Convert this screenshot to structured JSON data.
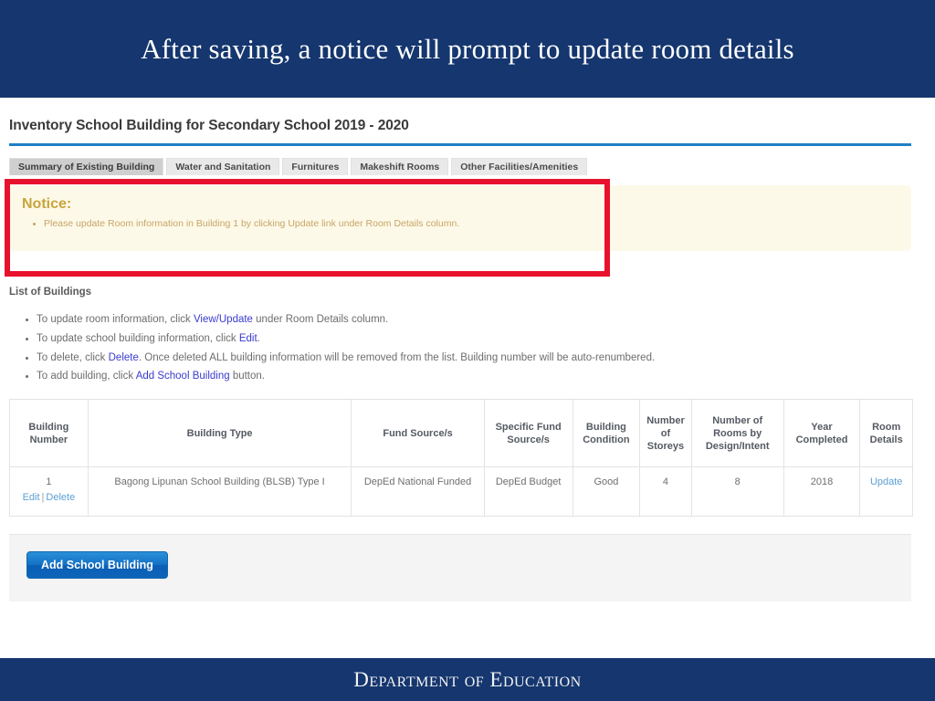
{
  "slide": {
    "title": "After saving, a notice will prompt to update room details",
    "band_color": "#15366e",
    "footer_text": "Department of Education"
  },
  "page": {
    "heading": "Inventory School Building for Secondary School 2019 - 2020",
    "rule_color": "#1f7fc4"
  },
  "tabs": [
    {
      "label": "Summary of Existing Building",
      "active": true
    },
    {
      "label": "Water and Sanitation",
      "active": false
    },
    {
      "label": "Furnitures",
      "active": false
    },
    {
      "label": "Makeshift Rooms",
      "active": false
    },
    {
      "label": "Other Facilities/Amenities",
      "active": false
    }
  ],
  "notice": {
    "title": "Notice:",
    "items": [
      "Please update Room information in Building 1 by clicking Update link under Room Details column."
    ],
    "background": "#fdf9e8",
    "title_color": "#c9a43c",
    "text_color": "#c7a567"
  },
  "annotation": {
    "shape": "rectangle",
    "color": "#e8112d"
  },
  "buildings_section": {
    "subheading": "List of Buildings",
    "instructions": [
      {
        "before": "To update room information, click ",
        "link": "View/Update",
        "after": " under Room Details column."
      },
      {
        "before": "To update school building information, click ",
        "link": "Edit",
        "after": "."
      },
      {
        "before": "To delete, click ",
        "link": "Delete",
        "after": ". Once deleted ALL building information will be removed from the list. Building number will be auto-renumbered."
      },
      {
        "before": "To add building, click ",
        "link": "Add School Building",
        "after": " button."
      }
    ]
  },
  "table": {
    "headers": [
      "Building Number",
      "Building Type",
      "Fund Source/s",
      "Specific Fund Source/s",
      "Building Condition",
      "Number of Storeys",
      "Number of Rooms by Design/Intent",
      "Year Completed",
      "Room Details"
    ],
    "rows": [
      {
        "building_number": "1",
        "edit_label": "Edit",
        "separator": "|",
        "delete_label": "Delete",
        "building_type": "Bagong Lipunan School Building (BLSB) Type I",
        "fund_source": "DepEd National Funded",
        "specific_fund_source": "DepEd Budget",
        "building_condition": "Good",
        "storeys": "4",
        "rooms": "8",
        "year_completed": "2018",
        "room_details_link": "Update"
      }
    ]
  },
  "actions": {
    "add_building_label": "Add School Building"
  }
}
